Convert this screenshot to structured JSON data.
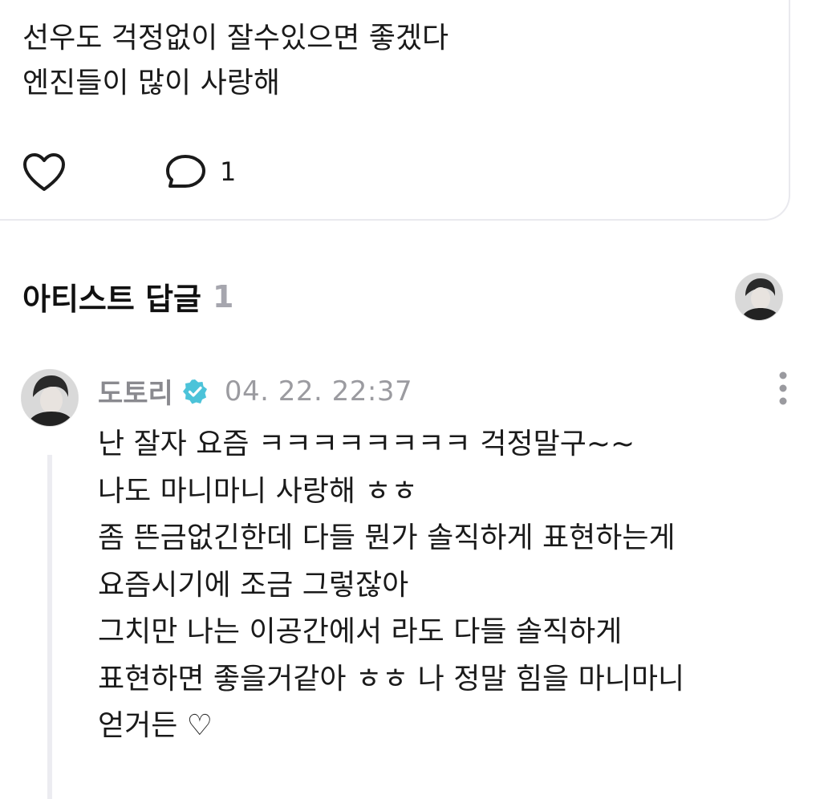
{
  "post": {
    "lines": [
      "선우도 걱정없이 잘수있으면 좋겠다",
      "엔진들이 많이 사랑해"
    ],
    "like_icon": "heart-outline-icon",
    "comment_icon": "speech-bubble-icon",
    "comment_count": "1"
  },
  "artist_replies": {
    "title": "아티스트 답글",
    "count": "1",
    "avatar_icon": "artist-avatar"
  },
  "reply": {
    "author": "도토리",
    "verified_icon": "verified-badge-icon",
    "verified_color": "#4cc3d9",
    "date": "04. 22. 22:37",
    "more_icon": "kebab-menu-icon",
    "lines": [
      "난 잘자 요즘 ㅋㅋㅋㅋㅋㅋㅋㅋ 걱정말구~~",
      "나도 마니마니 사랑해 ㅎㅎ",
      "좀 뜬금없긴한데 다들 뭔가 솔직하게 표현하는게",
      "요즘시기에 조금 그렇잖아",
      "그치만 나는 이공간에서 라도 다들 솔직하게",
      "표현하면 좋을거같아 ㅎㅎ 나 정말 힘을 마니마니",
      "얻거든 ♡"
    ]
  }
}
